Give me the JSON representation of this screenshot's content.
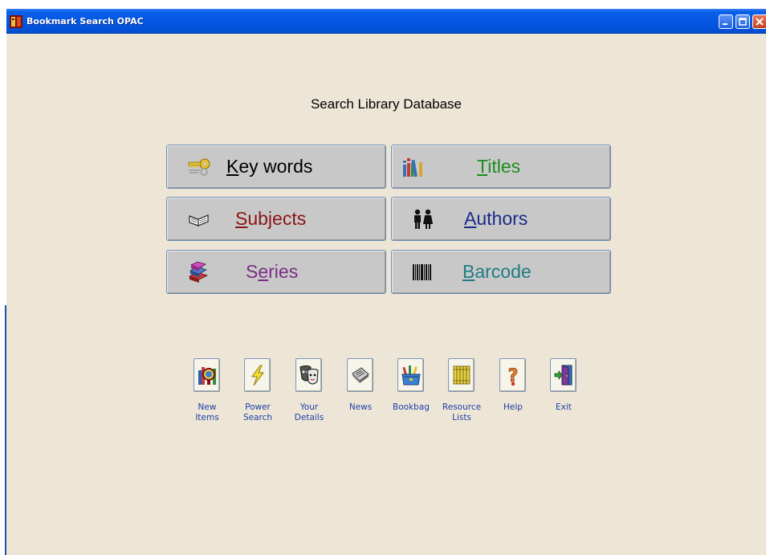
{
  "window": {
    "title": "Bookmark Search OPAC"
  },
  "heading": "Search Library Database",
  "search_buttons": [
    {
      "label_accent": "K",
      "label_rest": "ey words",
      "color": "#000000",
      "icon": "key-icon"
    },
    {
      "label_accent": "T",
      "label_rest": "itles",
      "color": "#1e8c1e",
      "icon": "books-shelf-icon"
    },
    {
      "label_accent": "S",
      "label_rest": "ubjects",
      "color": "#8b1414",
      "icon": "open-book-icon"
    },
    {
      "label_accent": "A",
      "label_rest": "uthors",
      "color": "#1a2a8a",
      "icon": "people-icon"
    },
    {
      "label_pre": "S",
      "label_accent": "e",
      "label_rest": "ries",
      "color": "#7b2d86",
      "icon": "book-stack-icon"
    },
    {
      "label_accent": "B",
      "label_rest": "arcode",
      "color": "#1f7b84",
      "icon": "barcode-icon"
    }
  ],
  "toolbar": [
    {
      "line1": "New",
      "line2": "Items",
      "icon": "new-items-icon"
    },
    {
      "line1": "Power",
      "line2": "Search",
      "icon": "lightning-icon"
    },
    {
      "line1": "Your",
      "line2": "Details",
      "icon": "masks-icon"
    },
    {
      "line1": "News",
      "line2": "",
      "icon": "newspaper-icon"
    },
    {
      "line1": "Bookbag",
      "line2": "",
      "icon": "bookbag-icon"
    },
    {
      "line1": "Resource",
      "line2": "Lists",
      "icon": "resource-lists-icon"
    },
    {
      "line1": "Help",
      "line2": "",
      "icon": "help-icon"
    },
    {
      "line1": "Exit",
      "line2": "",
      "icon": "exit-door-icon"
    }
  ]
}
